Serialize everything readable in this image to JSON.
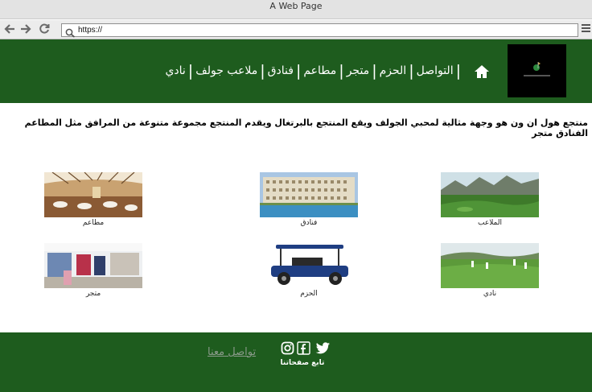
{
  "browser": {
    "window_title": "A Web Page",
    "url": "https://"
  },
  "header": {
    "logo_alt": "ALPHA ONE",
    "nav": [
      "التواصل",
      "الحزم",
      "متجر",
      "مطاعم",
      "فنادق",
      "ملاعب جولف",
      "نادي"
    ]
  },
  "intro": {
    "text": "منتجع هول ان ون هو وجهة مثالية لمحبي الجولف ويقع المنتجع بالبرتغال ويقدم المنتجع مجموعة متنوعة من المرافق مثل المطاعم الفنادق متجر"
  },
  "cards": [
    {
      "label": "الملاعب",
      "image": "golf-course-photo"
    },
    {
      "label": "فنادق",
      "image": "hotel-photo"
    },
    {
      "label": "مطاعم",
      "image": "restaurant-photo"
    },
    {
      "label": "نادي",
      "image": "golf-club-photo"
    },
    {
      "label": "الحزم",
      "image": "golf-cart-photo"
    },
    {
      "label": "متجر",
      "image": "shop-photo"
    }
  ],
  "footer": {
    "contact_link": "تواصل معنا",
    "follow_text": "تابع صفحاتنا",
    "social_icons": [
      "instagram-icon",
      "facebook-icon",
      "twitter-icon"
    ]
  },
  "colors": {
    "brand_green": "#1e5c1e",
    "text_white": "#ffffff"
  }
}
